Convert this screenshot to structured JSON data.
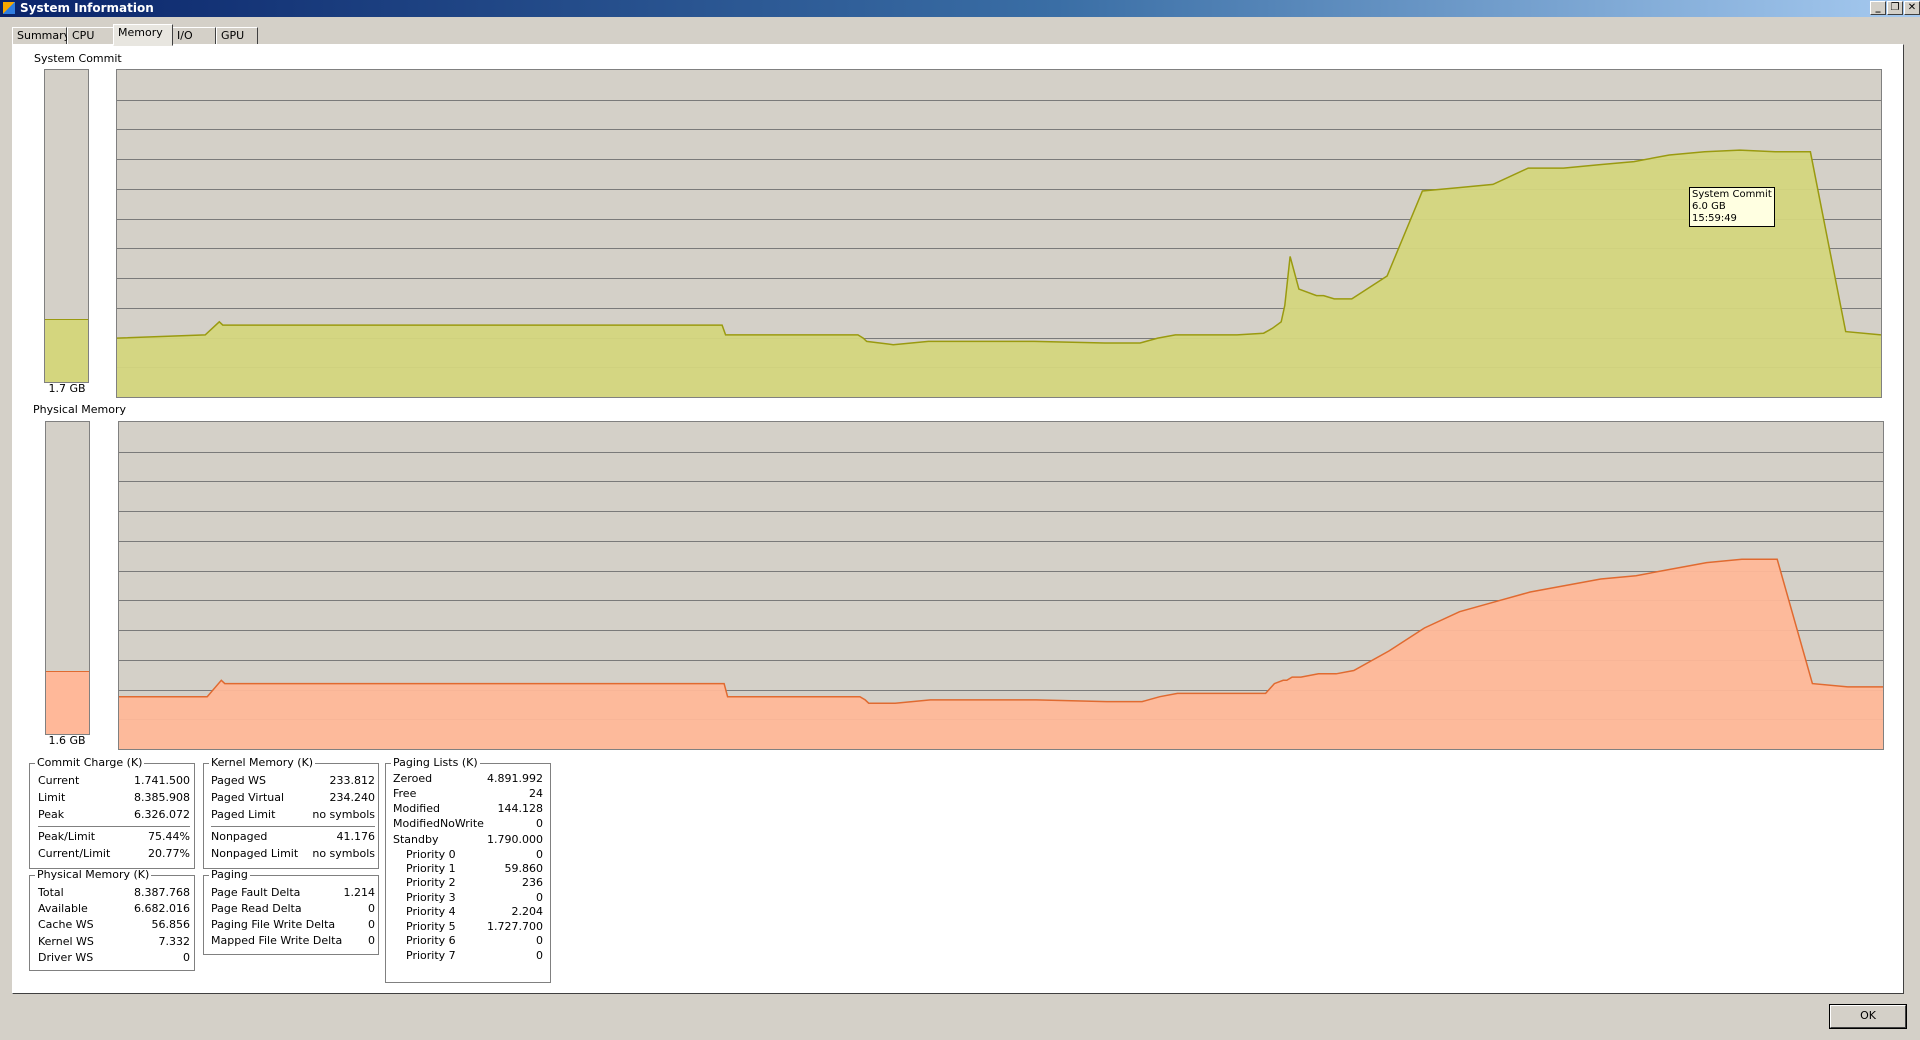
{
  "window": {
    "title": "System Information",
    "icon": "system-info-icon"
  },
  "tabs": [
    {
      "label": "Summary",
      "active": false
    },
    {
      "label": "CPU",
      "active": false
    },
    {
      "label": "Memory",
      "active": true
    },
    {
      "label": "I/O",
      "active": false
    },
    {
      "label": "GPU",
      "active": false
    }
  ],
  "system_commit": {
    "label": "System Commit",
    "bar_value": "1.7 GB",
    "bar_fill": 0.2,
    "color_fill": "#d4d67e",
    "color_line": "#9a9a10",
    "tooltip": {
      "name": "System Commit",
      "value": "6.0 GB",
      "time": "15:59:49"
    }
  },
  "physical_memory_graph": {
    "label": "Physical Memory",
    "bar_value": "1.6 GB",
    "bar_fill": 0.2,
    "color_fill": "#ffb899",
    "color_line": "#e06a30"
  },
  "commit_charge": {
    "title": "Commit Charge (K)",
    "rows": [
      {
        "label": "Current",
        "value": "1.741.500"
      },
      {
        "label": "Limit",
        "value": "8.385.908"
      },
      {
        "label": "Peak",
        "value": "6.326.072"
      }
    ],
    "rows2": [
      {
        "label": "Peak/Limit",
        "value": "75.44%"
      },
      {
        "label": "Current/Limit",
        "value": "20.77%"
      }
    ]
  },
  "kernel_memory": {
    "title": "Kernel Memory (K)",
    "rows": [
      {
        "label": "Paged WS",
        "value": "233.812"
      },
      {
        "label": "Paged Virtual",
        "value": "234.240"
      },
      {
        "label": "Paged Limit",
        "value": "no symbols"
      }
    ],
    "rows2": [
      {
        "label": "Nonpaged",
        "value": "41.176"
      },
      {
        "label": "Nonpaged Limit",
        "value": "no symbols"
      }
    ]
  },
  "paging_lists": {
    "title": "Paging Lists (K)",
    "rows": [
      {
        "label": "Zeroed",
        "value": "4.891.992"
      },
      {
        "label": "Free",
        "value": "24"
      },
      {
        "label": "Modified",
        "value": "144.128"
      },
      {
        "label": "ModifiedNoWrite",
        "value": "0"
      },
      {
        "label": "Standby",
        "value": "1.790.000"
      }
    ],
    "priorities": [
      {
        "label": "Priority 0",
        "value": "0"
      },
      {
        "label": "Priority 1",
        "value": "59.860"
      },
      {
        "label": "Priority 2",
        "value": "236"
      },
      {
        "label": "Priority 3",
        "value": "0"
      },
      {
        "label": "Priority 4",
        "value": "2.204"
      },
      {
        "label": "Priority 5",
        "value": "1.727.700"
      },
      {
        "label": "Priority 6",
        "value": "0"
      },
      {
        "label": "Priority 7",
        "value": "0"
      }
    ]
  },
  "physical_memory": {
    "title": "Physical Memory (K)",
    "rows": [
      {
        "label": "Total",
        "value": "8.387.768"
      },
      {
        "label": "Available",
        "value": "6.682.016"
      },
      {
        "label": "Cache WS",
        "value": "56.856"
      },
      {
        "label": "Kernel WS",
        "value": "7.332"
      },
      {
        "label": "Driver WS",
        "value": "0"
      }
    ]
  },
  "paging": {
    "title": "Paging",
    "rows": [
      {
        "label": "Page Fault Delta",
        "value": "1.214"
      },
      {
        "label": "Page Read Delta",
        "value": "0"
      },
      {
        "label": "Paging File Write Delta",
        "value": "0"
      },
      {
        "label": "Mapped File Write Delta",
        "value": "0"
      }
    ]
  },
  "buttons": {
    "ok": "OK"
  },
  "chart_data": [
    {
      "type": "area",
      "x": [
        0,
        5,
        5.8,
        6,
        10,
        12,
        16,
        20,
        24,
        34.3,
        34.5,
        40,
        42,
        42.3,
        42.5,
        44,
        46,
        48,
        52,
        56,
        58,
        59,
        60,
        61,
        62,
        63,
        63.5,
        65,
        65.5,
        66,
        66.2,
        66.5,
        67,
        68,
        68.4,
        69,
        70,
        72,
        74,
        76,
        78,
        80,
        82,
        84,
        86,
        88,
        90,
        92,
        94,
        96,
        98,
        100
      ],
      "series": [
        {
          "values": [
            18,
            19,
            23,
            22,
            22,
            22,
            22,
            22,
            22,
            22,
            19,
            19,
            19,
            18,
            17,
            16,
            17,
            17,
            17,
            16.5,
            16.5,
            18,
            19,
            19,
            19,
            19,
            19,
            19.5,
            21,
            23,
            28,
            43,
            33,
            31,
            31,
            30,
            30,
            37,
            63,
            64,
            65,
            70,
            70,
            71,
            72,
            74,
            75,
            75.5,
            75,
            75,
            20,
            19
          ]
        }
      ]
    },
    {
      "type": "area",
      "x": [
        0,
        5,
        5.8,
        6,
        10,
        12,
        16,
        20,
        24,
        34.3,
        34.5,
        40,
        42,
        42.3,
        42.5,
        44,
        46,
        48,
        52,
        56,
        58,
        59,
        60,
        61,
        62,
        63,
        63.5,
        65,
        65.5,
        66,
        66.2,
        66.5,
        67,
        68,
        68.4,
        69,
        70,
        72,
        74,
        76,
        78,
        80,
        82,
        84,
        86,
        88,
        90,
        92,
        94,
        96,
        98,
        100
      ],
      "series": [
        {
          "values": [
            16,
            16,
            21,
            20,
            20,
            20,
            20,
            20,
            20,
            20,
            16,
            16,
            16,
            15,
            14,
            14,
            15,
            15,
            15,
            14.5,
            14.5,
            16,
            17,
            17,
            17,
            17,
            17,
            17,
            20,
            21,
            21,
            22,
            22,
            23,
            23,
            23,
            24,
            30,
            37,
            42,
            45,
            48,
            50,
            52,
            53,
            55,
            57,
            58,
            58,
            20,
            19,
            19
          ]
        }
      ]
    }
  ]
}
